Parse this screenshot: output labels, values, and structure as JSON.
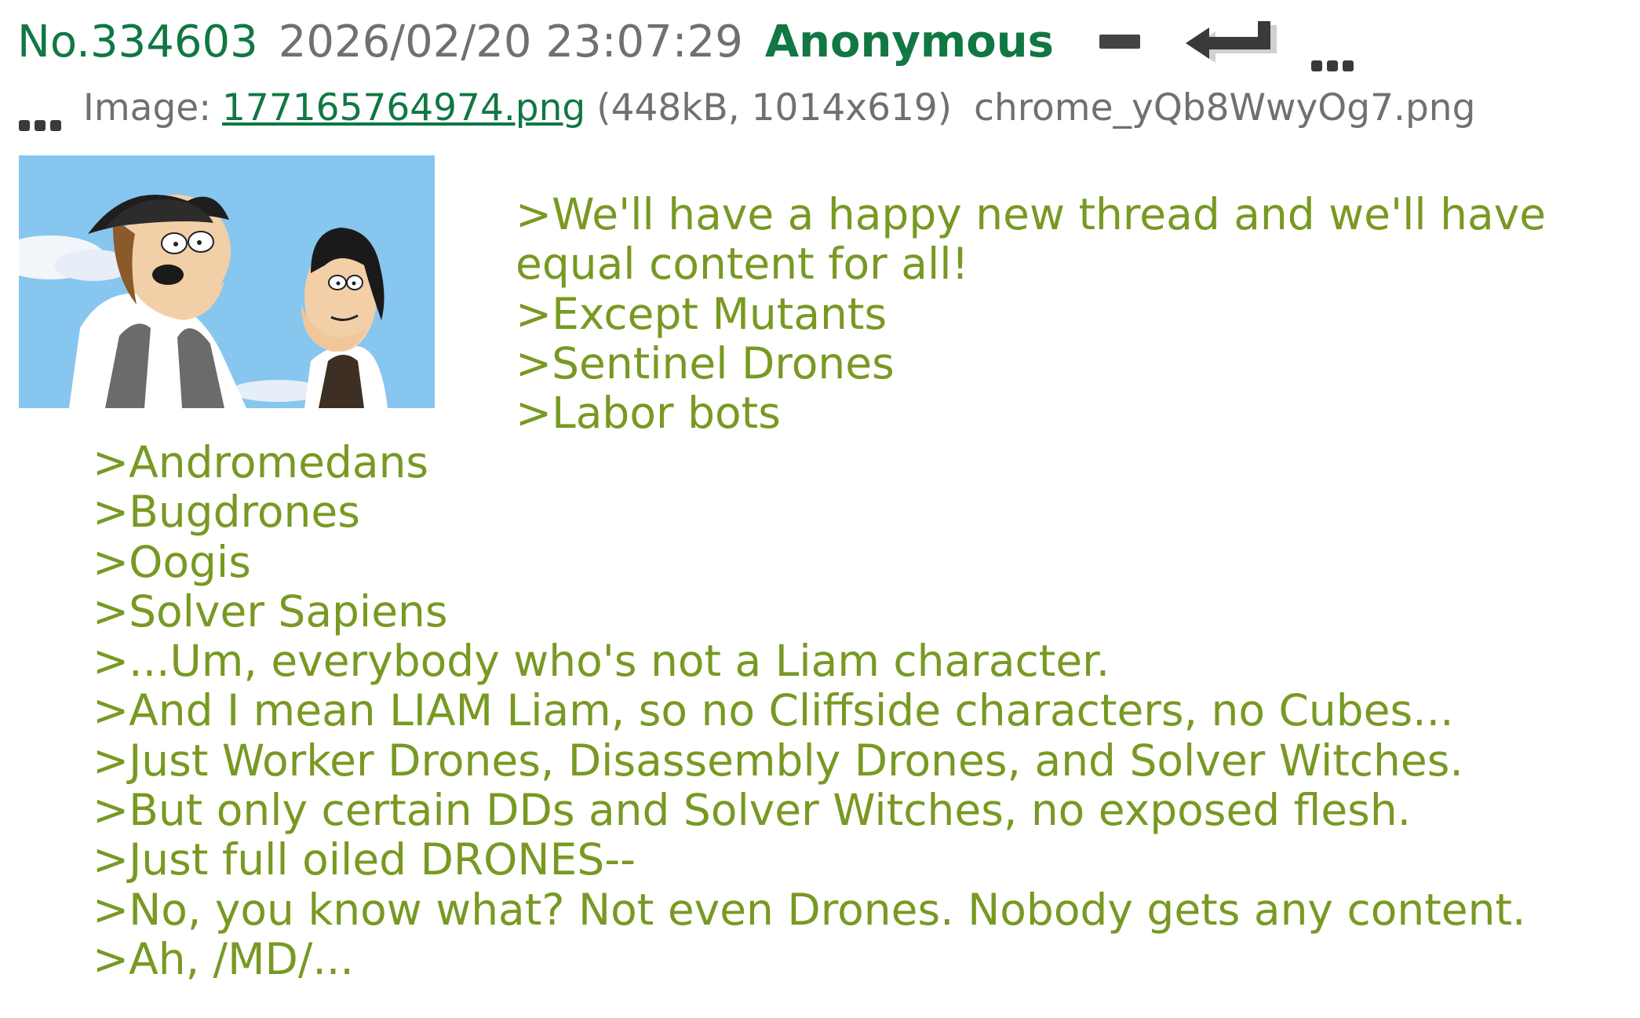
{
  "post": {
    "number": "No.334603",
    "datetime": "2026/02/20 23:07:29",
    "name": "Anonymous",
    "file": {
      "label": "Image:",
      "filename": "177165764974.png",
      "meta": "(448kB, 1014x619)",
      "original_name": "chrome_yQb8WwyOg7.png"
    },
    "thumbnail": {
      "sky_color": "#87C6EE"
    },
    "message_top": [
      ">We'll have a happy new thread and we'll have equal content for all!",
      ">Except Mutants",
      ">Sentinel Drones",
      ">Labor bots"
    ],
    "message_bottom": [
      ">Andromedans",
      ">Bugdrones",
      ">Oogis",
      ">Solver Sapiens",
      ">...Um, everybody who's not a Liam character.",
      ">And I mean LIAM Liam, so no Cliffside characters, no Cubes...",
      ">Just Worker Drones, Disassembly Drones, and Solver Witches.",
      ">But only certain DDs and Solver Witches, no exposed flesh.",
      ">Just full oiled DRONES--",
      ">No, you know what? Not even Drones. Nobody gets any content.",
      ">Ah, /MD/..."
    ]
  },
  "icons": {
    "hide": "minus-icon",
    "reply": "reply-arrow-icon",
    "menu": "ellipsis-menu-icon",
    "file_menu": "ellipsis-menu-icon"
  },
  "colors": {
    "name_green": "#117743",
    "greentext": "#789922",
    "meta_gray": "#707070"
  }
}
